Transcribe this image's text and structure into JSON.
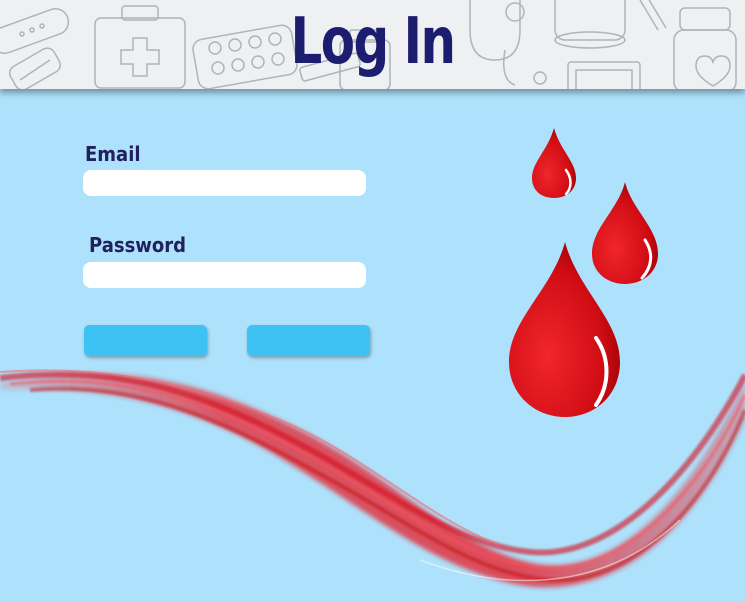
{
  "header": {
    "title": "Log In"
  },
  "form": {
    "email_label": "Email",
    "email_value": "",
    "password_label": "Password",
    "password_value": "",
    "primary_button_label": "",
    "secondary_button_label": ""
  },
  "colors": {
    "background": "#aee1fb",
    "title": "#1c1d6e",
    "button": "#3ec2f4",
    "blood": "#d4111a"
  }
}
